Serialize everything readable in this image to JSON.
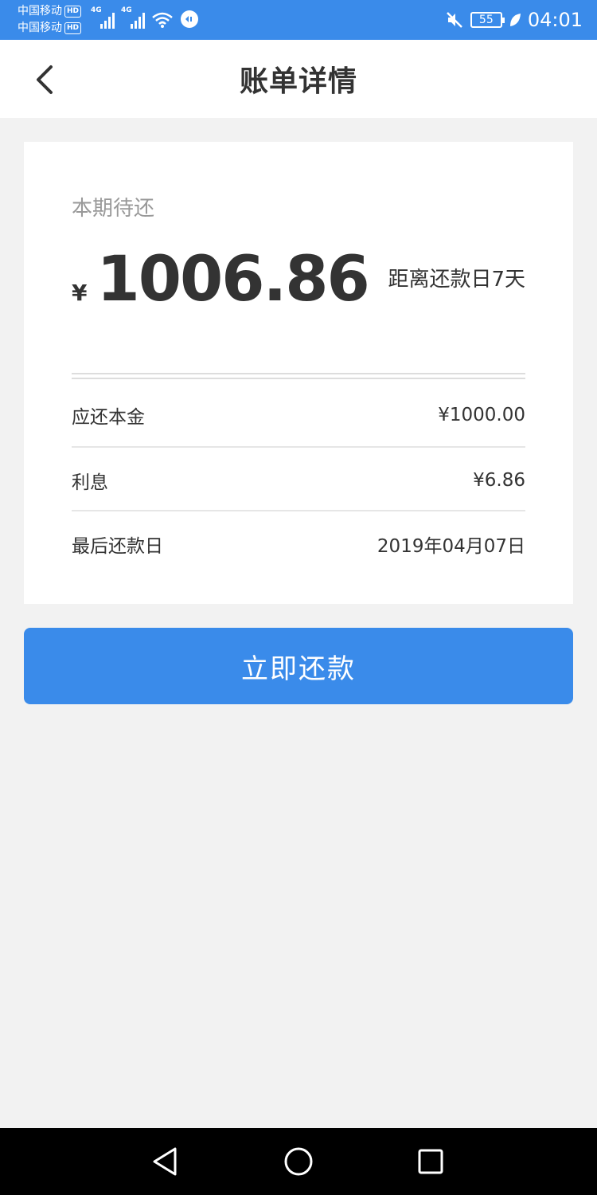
{
  "status_bar": {
    "carriers": [
      {
        "name": "中国移动",
        "badge": "HD"
      },
      {
        "name": "中国移动",
        "badge": "HD"
      }
    ],
    "network_types": [
      "4G",
      "4G"
    ],
    "battery_level": "55",
    "time": "04:01",
    "icons": [
      "signal-icon",
      "wifi-icon",
      "vpn-icon",
      "mute-icon",
      "battery-icon",
      "leaf-icon"
    ]
  },
  "header": {
    "title": "账单详情",
    "back_icon": "back-arrow-icon"
  },
  "bill": {
    "due_label": "本期待还",
    "currency_symbol": "¥",
    "amount": "1006.86",
    "days_left": "距离还款日7天",
    "rows": [
      {
        "label": "应还本金",
        "value": "¥1000.00"
      },
      {
        "label": "利息",
        "value": "¥6.86"
      },
      {
        "label": "最后还款日",
        "value": "2019年04月07日"
      }
    ]
  },
  "actions": {
    "pay_now": "立即还款"
  },
  "nav_bar": {
    "icons": [
      "back-triangle-icon",
      "home-circle-icon",
      "recents-square-icon"
    ]
  },
  "colors": {
    "primary": "#3a8bea",
    "background": "#f2f2f2",
    "text": "#333333",
    "muted": "#999999"
  }
}
